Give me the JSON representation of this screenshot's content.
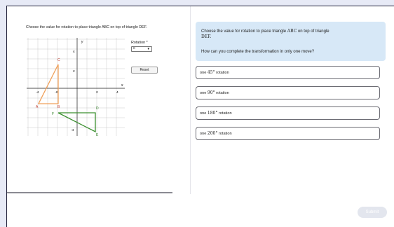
{
  "question": {
    "instruction": "Choose the value for rotation to place triangle ABC on top of triangle DEF.",
    "prompt_line1": "Choose the value for rotation to place triangle",
    "prompt_abc": "ABC",
    "prompt_line1_end": "on top of triangle",
    "prompt_def": "DEF.",
    "prompt_line2": "How can you complete the transformation in only one move?"
  },
  "controls": {
    "rotation_label": "Rotation *",
    "rotation_value": "0",
    "reset_label": "Reset"
  },
  "graph": {
    "axis_x_label": "x",
    "axis_y_label": "y",
    "x_ticks": [
      "-4",
      "-2",
      "2",
      "4"
    ],
    "y_ticks": [
      "4",
      "2",
      "-2",
      "-4"
    ],
    "points": {
      "A": "A",
      "B": "B",
      "C": "C",
      "D": "D",
      "E": "E",
      "F": "F"
    },
    "colors": {
      "abc": "#f0a05a",
      "def": "#3a8f2e"
    }
  },
  "options": [
    {
      "prefix": "one",
      "angle": "45",
      "unit": "°",
      "suffix": "rotation"
    },
    {
      "prefix": "one",
      "angle": "90",
      "unit": "°",
      "suffix": "rotation"
    },
    {
      "prefix": "one",
      "angle": "180",
      "unit": "°",
      "suffix": "rotation"
    },
    {
      "prefix": "one",
      "angle": "200",
      "unit": "°",
      "suffix": "rotation"
    }
  ],
  "submit_label": "Submit"
}
